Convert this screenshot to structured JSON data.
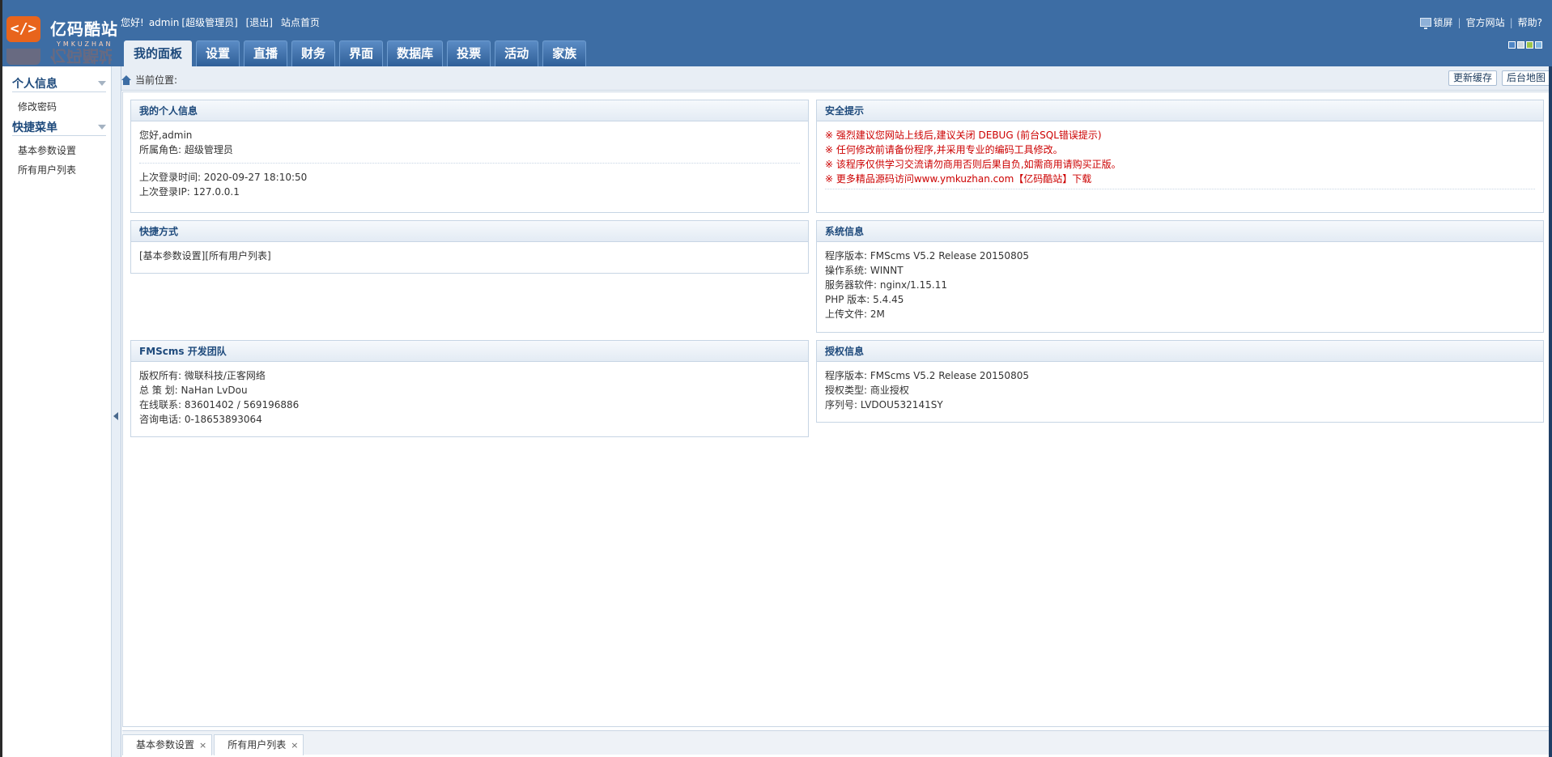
{
  "brand": {
    "mark": "</>",
    "title": "亿码酷站",
    "subtitle": "YMKUZHAN"
  },
  "header": {
    "greeting": "您好!",
    "username": "admin",
    "role": "[超级管理员]",
    "logout": "[退出]",
    "site_home": "站点首页",
    "lock_screen": "锁屏",
    "official_site": "官方网站",
    "help": "帮助?",
    "sep": "|"
  },
  "nav": {
    "tabs": [
      "我的面板",
      "设置",
      "直播",
      "财务",
      "界面",
      "数据库",
      "投票",
      "活动",
      "家族"
    ]
  },
  "skins": {
    "colors": [
      "#4f86c6",
      "#c9d4df",
      "#9cc54b",
      "#7fb5e0"
    ]
  },
  "sidebar": {
    "sections": [
      {
        "title": "个人信息",
        "items": [
          "修改密码"
        ]
      },
      {
        "title": "快捷菜单",
        "items": [
          "基本参数设置",
          "所有用户列表"
        ]
      }
    ]
  },
  "breadcrumb": {
    "label": "当前位置:",
    "refresh_cache": "更新缓存",
    "admin_map": "后台地图"
  },
  "panels": {
    "profile": {
      "title": "我的个人信息",
      "hello": "您好,admin",
      "role": "所属角色: 超级管理员",
      "last_login_time": "上次登录时间: 2020-09-27 18:10:50",
      "last_login_ip": "上次登录IP: 127.0.0.1"
    },
    "security": {
      "title": "安全提示",
      "lines": [
        "※ 强烈建议您网站上线后,建议关闭 DEBUG (前台SQL错误提示)",
        "※ 任何修改前请备份程序,并采用专业的编码工具修改。",
        "※ 该程序仅供学习交流请勿商用否则后果自负,如需商用请购买正版。",
        "※ 更多精品源码访问www.ymkuzhan.com【亿码酷站】下载"
      ]
    },
    "shortcuts": {
      "title": "快捷方式",
      "link1": "[基本参数设置]",
      "link2": "[所有用户列表]"
    },
    "sysinfo": {
      "title": "系统信息",
      "lines": [
        "程序版本: FMScms V5.2 Release 20150805",
        "操作系统: WINNT",
        "服务器软件: nginx/1.15.11",
        "PHP 版本: 5.4.45",
        "上传文件: 2M"
      ]
    },
    "team": {
      "title": "FMScms 开发团队",
      "lines": [
        "版权所有: 微联科技/正客网络",
        "总 策 划: NaHan LvDou",
        "在线联系: 83601402 / 569196886",
        "咨询电话: 0-18653893064"
      ]
    },
    "license": {
      "title": "授权信息",
      "lines": [
        "程序版本: FMScms V5.2 Release 20150805",
        "授权类型: 商业授权",
        "序列号: LVDOU532141SY"
      ]
    }
  },
  "taskbar": {
    "tabs": [
      "基本参数设置",
      "所有用户列表"
    ],
    "close": "×"
  }
}
